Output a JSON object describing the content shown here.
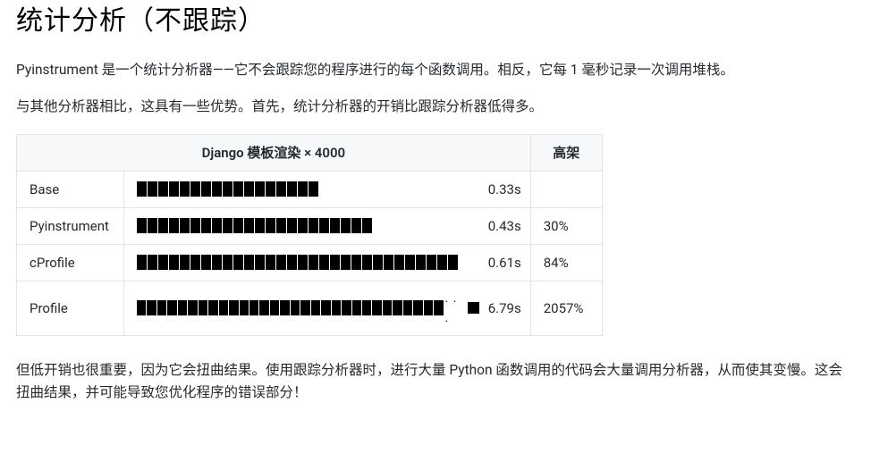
{
  "heading": "统计分析（不跟踪）",
  "para1": "Pyinstrument 是一个统计分析器——它不会跟踪您的程序进行的每个函数调用。相反，它每 1 毫秒记录一次调用堆栈。",
  "para2": "与其他分析器相比，这具有一些优势。首先，统计分析器的开销比跟踪分析器低得多。",
  "table": {
    "header_main": "Django 模板渲染 × 4000",
    "header_overhead": "高架",
    "rows": [
      {
        "name": "Base",
        "segments": 17,
        "truncated": false,
        "time": "0.33s",
        "overhead": ""
      },
      {
        "name": "Pyinstrument",
        "segments": 22,
        "truncated": false,
        "time": "0.43s",
        "overhead": "30%"
      },
      {
        "name": "cProfile",
        "segments": 30,
        "truncated": false,
        "time": "0.61s",
        "overhead": "84%"
      },
      {
        "name": "Profile",
        "segments": 30,
        "truncated": true,
        "time": "6.79s",
        "overhead": "2057%"
      }
    ]
  },
  "para3": "但低开销也很重要，因为它会扭曲结果。使用跟踪分析器时，进行大量 Python 函数调用的代码会大量调用分析器，从而使其变慢。这会扭曲结果，并可能导致您优化程序的错误部分！"
}
